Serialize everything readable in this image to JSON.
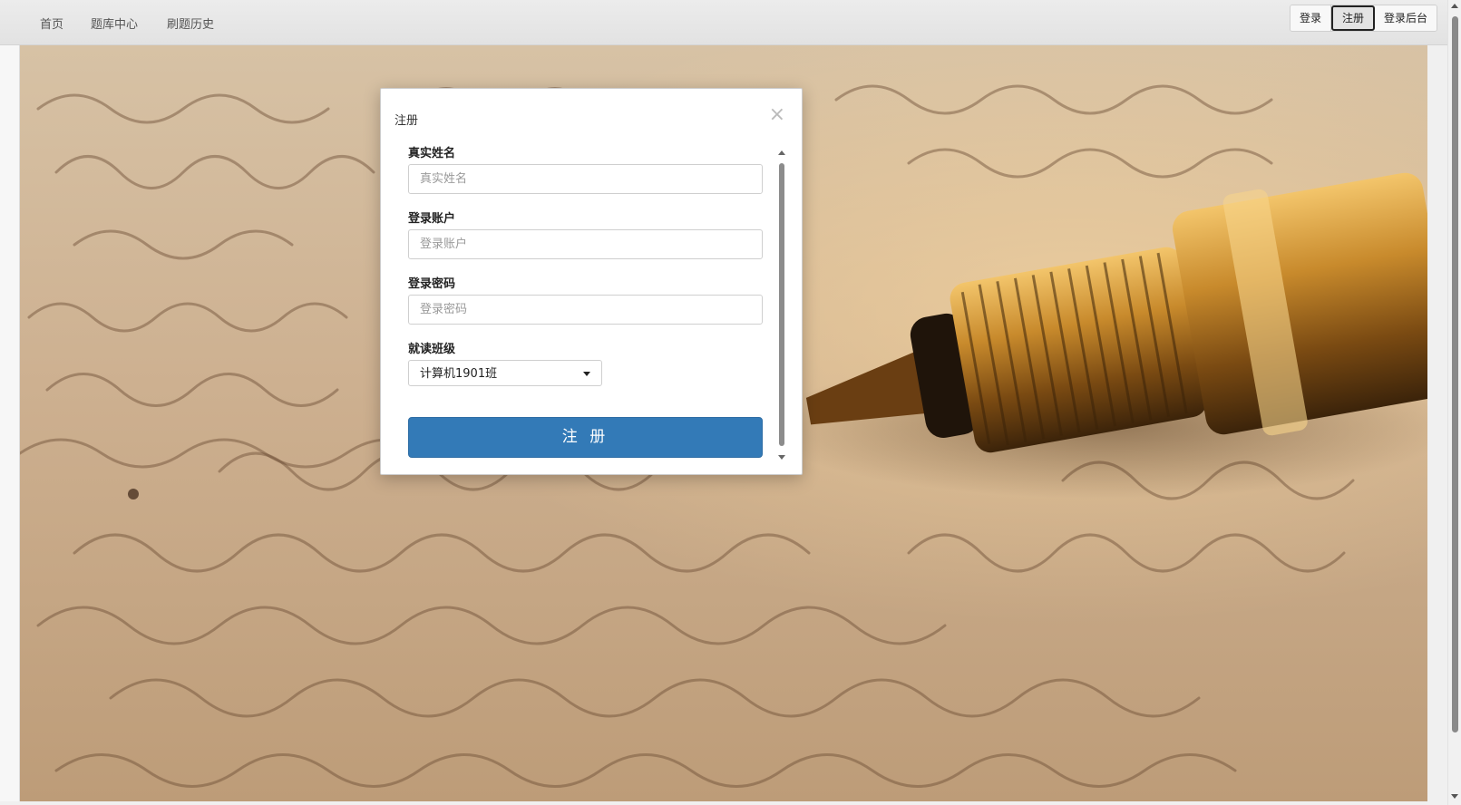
{
  "nav": {
    "links": [
      "首页",
      "题库中心",
      "刷题历史"
    ],
    "buttons": [
      "登录",
      "注册",
      "登录后台"
    ],
    "active_button": "注册"
  },
  "modal": {
    "title": "注册",
    "close_icon": "close-icon",
    "fields": [
      {
        "label": "真实姓名",
        "placeholder": "真实姓名",
        "value": ""
      },
      {
        "label": "登录账户",
        "placeholder": "登录账户",
        "value": ""
      },
      {
        "label": "登录密码",
        "placeholder": "登录密码",
        "value": ""
      }
    ],
    "class_field": {
      "label": "就读班级",
      "selected": "计算机1901班"
    },
    "submit_label": "注 册"
  },
  "colors": {
    "primary": "#337ab7",
    "navbar": "#e6e6e6"
  }
}
